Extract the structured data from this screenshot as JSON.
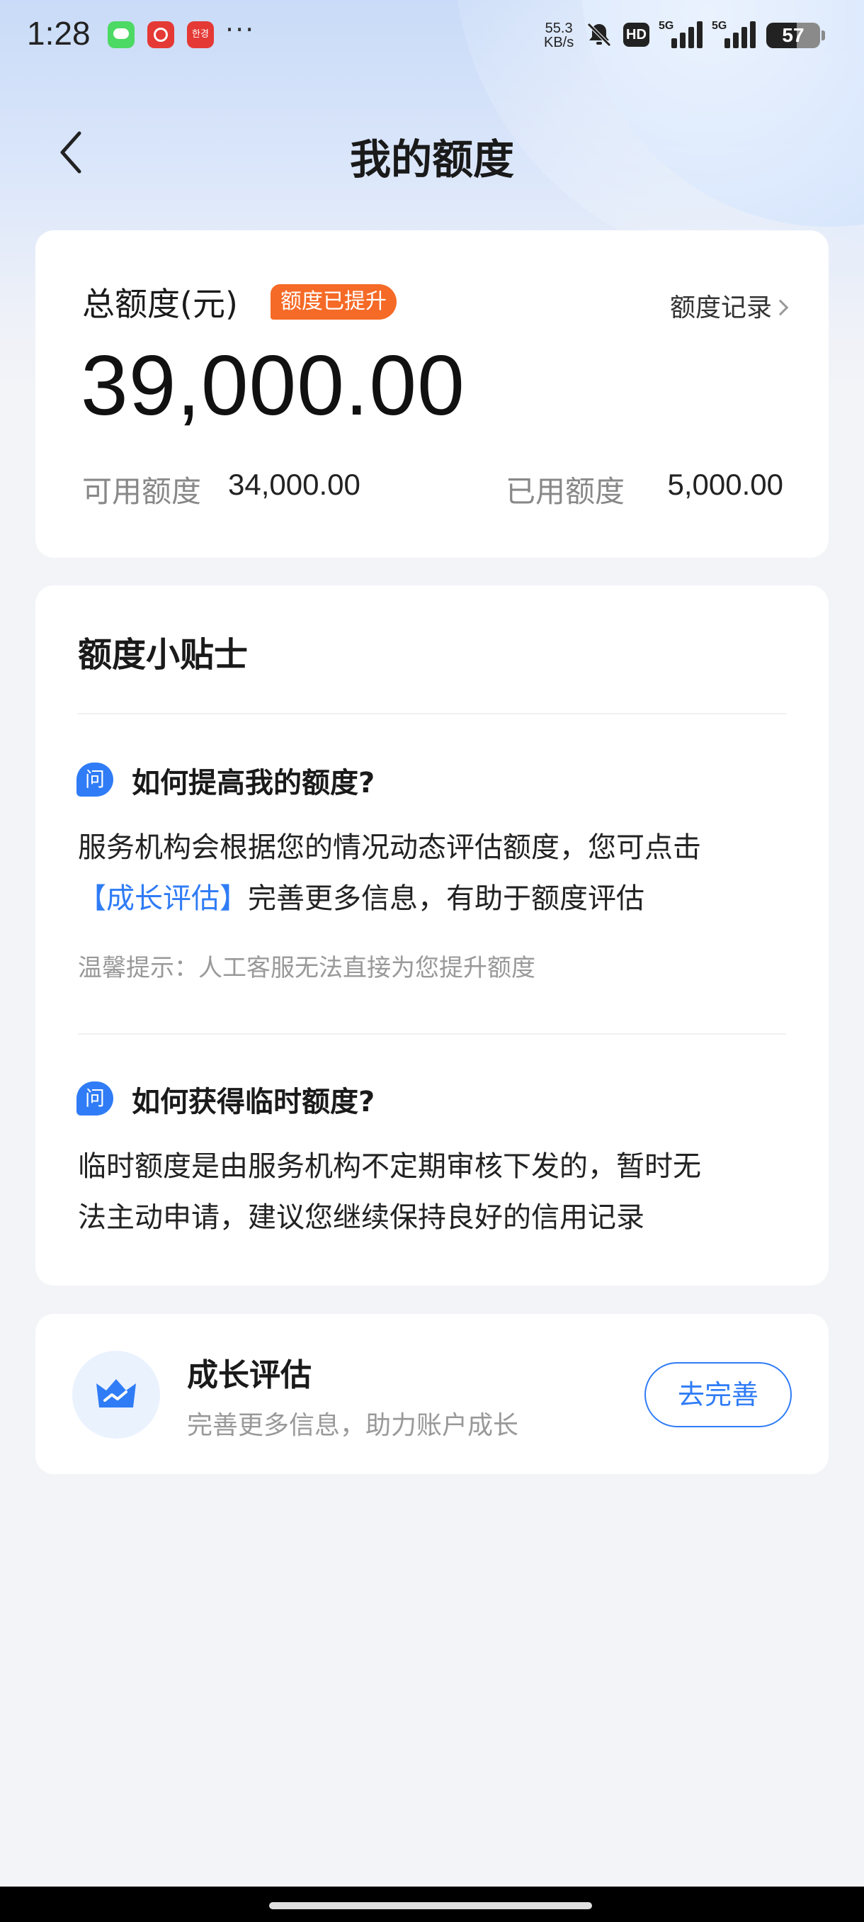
{
  "status_bar": {
    "time": "1:28",
    "app_badge_text": "한경",
    "more": "···",
    "net_speed_value": "55.3",
    "net_speed_unit": "KB/s",
    "hd": "HD",
    "signal1": "5G",
    "signal2": "5G",
    "battery": "57",
    "battery_level": 0.57
  },
  "nav": {
    "title": "我的额度"
  },
  "limit_card": {
    "label": "总额度(元)",
    "badge": "额度已提升",
    "record_link": "额度记录",
    "total": "39,000.00",
    "available_label": "可用额度",
    "available_value": "34,000.00",
    "used_label": "已用额度",
    "used_value": "5,000.00"
  },
  "tips": {
    "title": "额度小贴士",
    "q_icon": "问",
    "q1": {
      "title": "如何提高我的额度?",
      "body_line1": "服务机构会根据您的情况动态评估额度，您可点击",
      "body_link": "【成长评估】",
      "body_line2_rest": "完善更多信息，有助于额度评估",
      "hint": "温馨提示：人工客服无法直接为您提升额度"
    },
    "q2": {
      "title": "如何获得临时额度?",
      "body_line1": "临时额度是由服务机构不定期审核下发的，暂时无",
      "body_line2": "法主动申请，建议您继续保持良好的信用记录"
    }
  },
  "growth": {
    "title": "成长评估",
    "subtitle": "完善更多信息，助力账户成长",
    "button": "去完善"
  },
  "colors": {
    "accent_blue": "#2f7cf6",
    "badge_orange": "#f56a26",
    "background": "#f3f4f8"
  }
}
